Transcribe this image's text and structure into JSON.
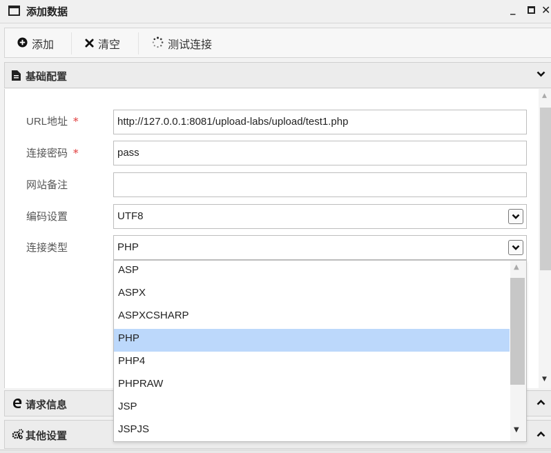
{
  "window": {
    "title": "添加数据",
    "minimize_label": "_",
    "close_label": "✕"
  },
  "toolbar": {
    "add_label": "添加",
    "clear_label": "清空",
    "test_label": "测试连接"
  },
  "sections": {
    "basic": "基础配置",
    "request": "请求信息",
    "other": "其他设置"
  },
  "form": {
    "url_label": "URL地址",
    "url_value": "http://127.0.0.1:8081/upload-labs/upload/test1.php",
    "password_label": "连接密码",
    "password_value": "pass",
    "note_label": "网站备注",
    "note_value": "",
    "encoding_label": "编码设置",
    "encoding_value": "UTF8",
    "type_label": "连接类型",
    "type_value": "PHP",
    "required_mark": "*"
  },
  "dropdown": {
    "options": [
      "ASP",
      "ASPX",
      "ASPXCSHARP",
      "PHP",
      "PHP4",
      "PHPRAW",
      "JSP",
      "JSPJS"
    ],
    "selected": "PHP"
  },
  "colors": {
    "selected_option": "#bcd8fb",
    "required": "#e03a3a"
  }
}
